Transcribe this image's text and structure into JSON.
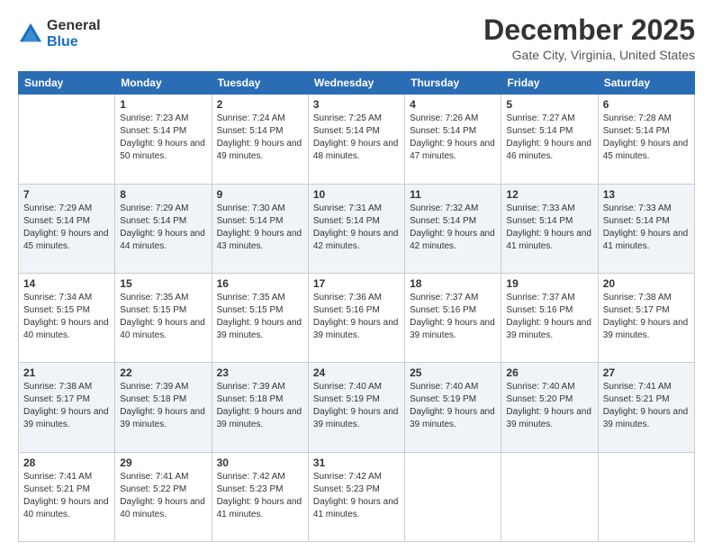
{
  "logo": {
    "general": "General",
    "blue": "Blue"
  },
  "header": {
    "month": "December 2025",
    "location": "Gate City, Virginia, United States"
  },
  "weekdays": [
    "Sunday",
    "Monday",
    "Tuesday",
    "Wednesday",
    "Thursday",
    "Friday",
    "Saturday"
  ],
  "weeks": [
    [
      {
        "day": "",
        "sunrise": "",
        "sunset": "",
        "daylight": ""
      },
      {
        "day": "1",
        "sunrise": "Sunrise: 7:23 AM",
        "sunset": "Sunset: 5:14 PM",
        "daylight": "Daylight: 9 hours and 50 minutes."
      },
      {
        "day": "2",
        "sunrise": "Sunrise: 7:24 AM",
        "sunset": "Sunset: 5:14 PM",
        "daylight": "Daylight: 9 hours and 49 minutes."
      },
      {
        "day": "3",
        "sunrise": "Sunrise: 7:25 AM",
        "sunset": "Sunset: 5:14 PM",
        "daylight": "Daylight: 9 hours and 48 minutes."
      },
      {
        "day": "4",
        "sunrise": "Sunrise: 7:26 AM",
        "sunset": "Sunset: 5:14 PM",
        "daylight": "Daylight: 9 hours and 47 minutes."
      },
      {
        "day": "5",
        "sunrise": "Sunrise: 7:27 AM",
        "sunset": "Sunset: 5:14 PM",
        "daylight": "Daylight: 9 hours and 46 minutes."
      },
      {
        "day": "6",
        "sunrise": "Sunrise: 7:28 AM",
        "sunset": "Sunset: 5:14 PM",
        "daylight": "Daylight: 9 hours and 45 minutes."
      }
    ],
    [
      {
        "day": "7",
        "sunrise": "Sunrise: 7:29 AM",
        "sunset": "Sunset: 5:14 PM",
        "daylight": "Daylight: 9 hours and 45 minutes."
      },
      {
        "day": "8",
        "sunrise": "Sunrise: 7:29 AM",
        "sunset": "Sunset: 5:14 PM",
        "daylight": "Daylight: 9 hours and 44 minutes."
      },
      {
        "day": "9",
        "sunrise": "Sunrise: 7:30 AM",
        "sunset": "Sunset: 5:14 PM",
        "daylight": "Daylight: 9 hours and 43 minutes."
      },
      {
        "day": "10",
        "sunrise": "Sunrise: 7:31 AM",
        "sunset": "Sunset: 5:14 PM",
        "daylight": "Daylight: 9 hours and 42 minutes."
      },
      {
        "day": "11",
        "sunrise": "Sunrise: 7:32 AM",
        "sunset": "Sunset: 5:14 PM",
        "daylight": "Daylight: 9 hours and 42 minutes."
      },
      {
        "day": "12",
        "sunrise": "Sunrise: 7:33 AM",
        "sunset": "Sunset: 5:14 PM",
        "daylight": "Daylight: 9 hours and 41 minutes."
      },
      {
        "day": "13",
        "sunrise": "Sunrise: 7:33 AM",
        "sunset": "Sunset: 5:14 PM",
        "daylight": "Daylight: 9 hours and 41 minutes."
      }
    ],
    [
      {
        "day": "14",
        "sunrise": "Sunrise: 7:34 AM",
        "sunset": "Sunset: 5:15 PM",
        "daylight": "Daylight: 9 hours and 40 minutes."
      },
      {
        "day": "15",
        "sunrise": "Sunrise: 7:35 AM",
        "sunset": "Sunset: 5:15 PM",
        "daylight": "Daylight: 9 hours and 40 minutes."
      },
      {
        "day": "16",
        "sunrise": "Sunrise: 7:35 AM",
        "sunset": "Sunset: 5:15 PM",
        "daylight": "Daylight: 9 hours and 39 minutes."
      },
      {
        "day": "17",
        "sunrise": "Sunrise: 7:36 AM",
        "sunset": "Sunset: 5:16 PM",
        "daylight": "Daylight: 9 hours and 39 minutes."
      },
      {
        "day": "18",
        "sunrise": "Sunrise: 7:37 AM",
        "sunset": "Sunset: 5:16 PM",
        "daylight": "Daylight: 9 hours and 39 minutes."
      },
      {
        "day": "19",
        "sunrise": "Sunrise: 7:37 AM",
        "sunset": "Sunset: 5:16 PM",
        "daylight": "Daylight: 9 hours and 39 minutes."
      },
      {
        "day": "20",
        "sunrise": "Sunrise: 7:38 AM",
        "sunset": "Sunset: 5:17 PM",
        "daylight": "Daylight: 9 hours and 39 minutes."
      }
    ],
    [
      {
        "day": "21",
        "sunrise": "Sunrise: 7:38 AM",
        "sunset": "Sunset: 5:17 PM",
        "daylight": "Daylight: 9 hours and 39 minutes."
      },
      {
        "day": "22",
        "sunrise": "Sunrise: 7:39 AM",
        "sunset": "Sunset: 5:18 PM",
        "daylight": "Daylight: 9 hours and 39 minutes."
      },
      {
        "day": "23",
        "sunrise": "Sunrise: 7:39 AM",
        "sunset": "Sunset: 5:18 PM",
        "daylight": "Daylight: 9 hours and 39 minutes."
      },
      {
        "day": "24",
        "sunrise": "Sunrise: 7:40 AM",
        "sunset": "Sunset: 5:19 PM",
        "daylight": "Daylight: 9 hours and 39 minutes."
      },
      {
        "day": "25",
        "sunrise": "Sunrise: 7:40 AM",
        "sunset": "Sunset: 5:19 PM",
        "daylight": "Daylight: 9 hours and 39 minutes."
      },
      {
        "day": "26",
        "sunrise": "Sunrise: 7:40 AM",
        "sunset": "Sunset: 5:20 PM",
        "daylight": "Daylight: 9 hours and 39 minutes."
      },
      {
        "day": "27",
        "sunrise": "Sunrise: 7:41 AM",
        "sunset": "Sunset: 5:21 PM",
        "daylight": "Daylight: 9 hours and 39 minutes."
      }
    ],
    [
      {
        "day": "28",
        "sunrise": "Sunrise: 7:41 AM",
        "sunset": "Sunset: 5:21 PM",
        "daylight": "Daylight: 9 hours and 40 minutes."
      },
      {
        "day": "29",
        "sunrise": "Sunrise: 7:41 AM",
        "sunset": "Sunset: 5:22 PM",
        "daylight": "Daylight: 9 hours and 40 minutes."
      },
      {
        "day": "30",
        "sunrise": "Sunrise: 7:42 AM",
        "sunset": "Sunset: 5:23 PM",
        "daylight": "Daylight: 9 hours and 41 minutes."
      },
      {
        "day": "31",
        "sunrise": "Sunrise: 7:42 AM",
        "sunset": "Sunset: 5:23 PM",
        "daylight": "Daylight: 9 hours and 41 minutes."
      },
      {
        "day": "",
        "sunrise": "",
        "sunset": "",
        "daylight": ""
      },
      {
        "day": "",
        "sunrise": "",
        "sunset": "",
        "daylight": ""
      },
      {
        "day": "",
        "sunrise": "",
        "sunset": "",
        "daylight": ""
      }
    ]
  ]
}
